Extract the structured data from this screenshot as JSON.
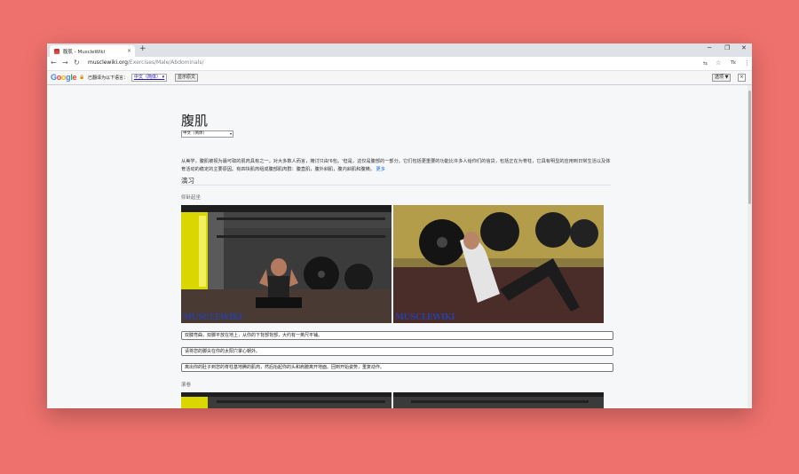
{
  "browser": {
    "tab_title": "腹肌 - MuscleWiki",
    "tab_close": "×",
    "new_tab": "+",
    "win_minimize": "─",
    "win_maximize": "❐",
    "win_close": "✕",
    "url_host": "musclewiki.org",
    "url_path": "/Exercises/Male/Abdominals/",
    "back": "←",
    "forward": "→",
    "reload": "↻",
    "translate_btn": "⇆",
    "bookmark": "☆",
    "account": "Tk",
    "menu": "⋮"
  },
  "translate_bar": {
    "logo_letters": [
      "G",
      "o",
      "o",
      "g",
      "l",
      "e"
    ],
    "lock": "🔒",
    "label": "已翻译为以下语言：",
    "language": "中文（简体）",
    "language_arrow": "▾",
    "show_original": "显示原文",
    "options": "选项 ▼",
    "close": "×"
  },
  "page": {
    "title": "腹肌",
    "language_select": "中文（简体）",
    "language_arrow": "▾",
    "description": "从美学，腹肌被视为最可取的肌肉具有之一。对大多数人而言，掩讨只由'6包。'但是，这仅是腹部的一部分。它们包括更重要的功能比许多人给你们的信贷，包括正在为脊柱，它具有明显的应用到日常生活以及体育活动的稳定的主要原因。有四块肌肉组成腹部肌肉群：腹直肌，腹外斜肌，腹内斜肌和腹横。",
    "more_link": "更多",
    "section_heading": "演习",
    "exercise_1": {
      "name": "仰卧起坐",
      "watermark": "MUSCLEWIKI",
      "steps": [
        "双膝弯曲，双脚平放在地上，从你的下背部背部，大约有一英尺平铺。",
        "请将您的脚尖在你的太阳穴掌心朝外。",
        "离出你的肚子到您的脊柱基地腾的肌肉，然后抬起你的头和肩膀离开地面。回到开始姿势，重复动作。"
      ]
    },
    "exercise_2": {
      "name": "滚卷"
    }
  },
  "colors": {
    "background": "#ee716d",
    "link": "#1a73e8",
    "watermark": "#2a3fa0"
  }
}
